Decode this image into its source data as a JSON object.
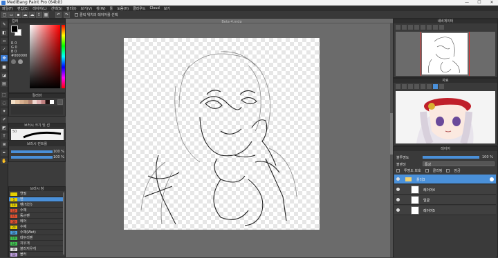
{
  "app": {
    "title": "MediBang Paint Pro (64bit)"
  },
  "window_controls": [
    "—",
    "☐",
    "✕"
  ],
  "menu": [
    "파일(F)",
    "편집(E)",
    "레이어(L)",
    "선택(S)",
    "필터(I)",
    "보기(V)",
    "창(W)",
    "툴",
    "도움(H)",
    "클라우드",
    "Cloud",
    "보기"
  ],
  "toolbar": {
    "snap_label": "클릭 위치의 레이어를 선택"
  },
  "document": {
    "name": "Beta-4.mdp"
  },
  "color_panel": {
    "title": "컬러",
    "r_label": "R 0",
    "g_label": "G 0",
    "b_label": "B 0",
    "hex": "#000000"
  },
  "palette_panel": {
    "title": "컬러바"
  },
  "brush_size_panel": {
    "title": "브러시 크기 및 선",
    "value": "50"
  },
  "brush_control_panel": {
    "title": "브러시 컨트롤",
    "opacity_value": "100 %",
    "size_value": "100 %"
  },
  "brush_list_panel": {
    "title": "브러시 창",
    "brushes": [
      {
        "size": "",
        "name": "연필"
      },
      {
        "size": "5",
        "name": "펜",
        "selected": true
      },
      {
        "size": "10",
        "name": "펜(직선)"
      },
      {
        "size": "10",
        "name": "수채"
      },
      {
        "size": "15",
        "name": "동근펜"
      },
      {
        "size": "30",
        "name": "에어"
      },
      {
        "size": "20",
        "name": "수채"
      },
      {
        "size": "50",
        "name": "수채(Wet)"
      },
      {
        "size": "10",
        "name": "데두리펜"
      },
      {
        "size": "10",
        "name": "지우개"
      },
      {
        "size": "30",
        "name": "블러지우개"
      },
      {
        "size": "50",
        "name": "블러"
      }
    ]
  },
  "navigator_panel": {
    "title": "네비게이터"
  },
  "material_panel": {
    "title": "자료"
  },
  "layer_panel": {
    "title": "레이어",
    "opacity_label": "불투명도",
    "opacity_value": "100 %",
    "blend_label": "블렌딩",
    "blend_value": "통상",
    "protect_label": "투명도 보호",
    "clip_label": "클리핑",
    "lock_label": "잠금",
    "layers": [
      {
        "name": "폴더3",
        "selected": true
      },
      {
        "name": "레이어4"
      },
      {
        "name": "얼굴"
      },
      {
        "name": "레이어5"
      }
    ]
  },
  "colors": {
    "accent": "#4a90d9",
    "bg": "#3c3c3c"
  }
}
